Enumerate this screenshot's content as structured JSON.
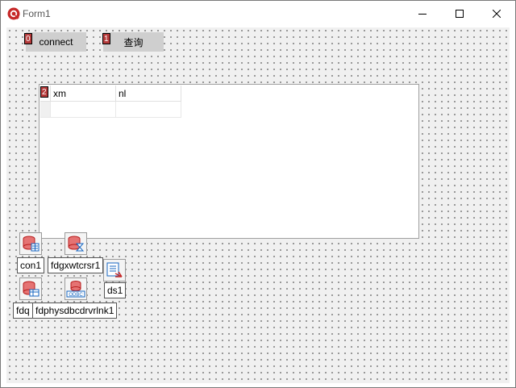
{
  "window": {
    "title": "Form1",
    "controls": [
      "minimize-icon",
      "maximize-icon",
      "close-icon"
    ]
  },
  "buttons": [
    {
      "label": "connect",
      "tab_order": "0"
    },
    {
      "label": "查询",
      "tab_order": "1"
    }
  ],
  "grid": {
    "tab_order": "2",
    "columns": [
      "xm",
      "nl"
    ]
  },
  "components": [
    {
      "name": "con1",
      "icon": "fdconnection-icon"
    },
    {
      "name": "fdgxwtcrsr1",
      "icon": "fdwaitcursor-icon"
    },
    {
      "name": "ds1",
      "icon": "datasource-icon"
    },
    {
      "name": "fdq",
      "icon": "fdquery-icon"
    },
    {
      "name": "fdphysdbcdrvrlnk1",
      "icon": "odbc-driver-link-icon"
    }
  ],
  "colors": {
    "client_bg": "#f0f0f0",
    "button_bg": "#cfcfcf",
    "tab_order_badge": "#b53a3a",
    "app_icon": "#c62828"
  }
}
